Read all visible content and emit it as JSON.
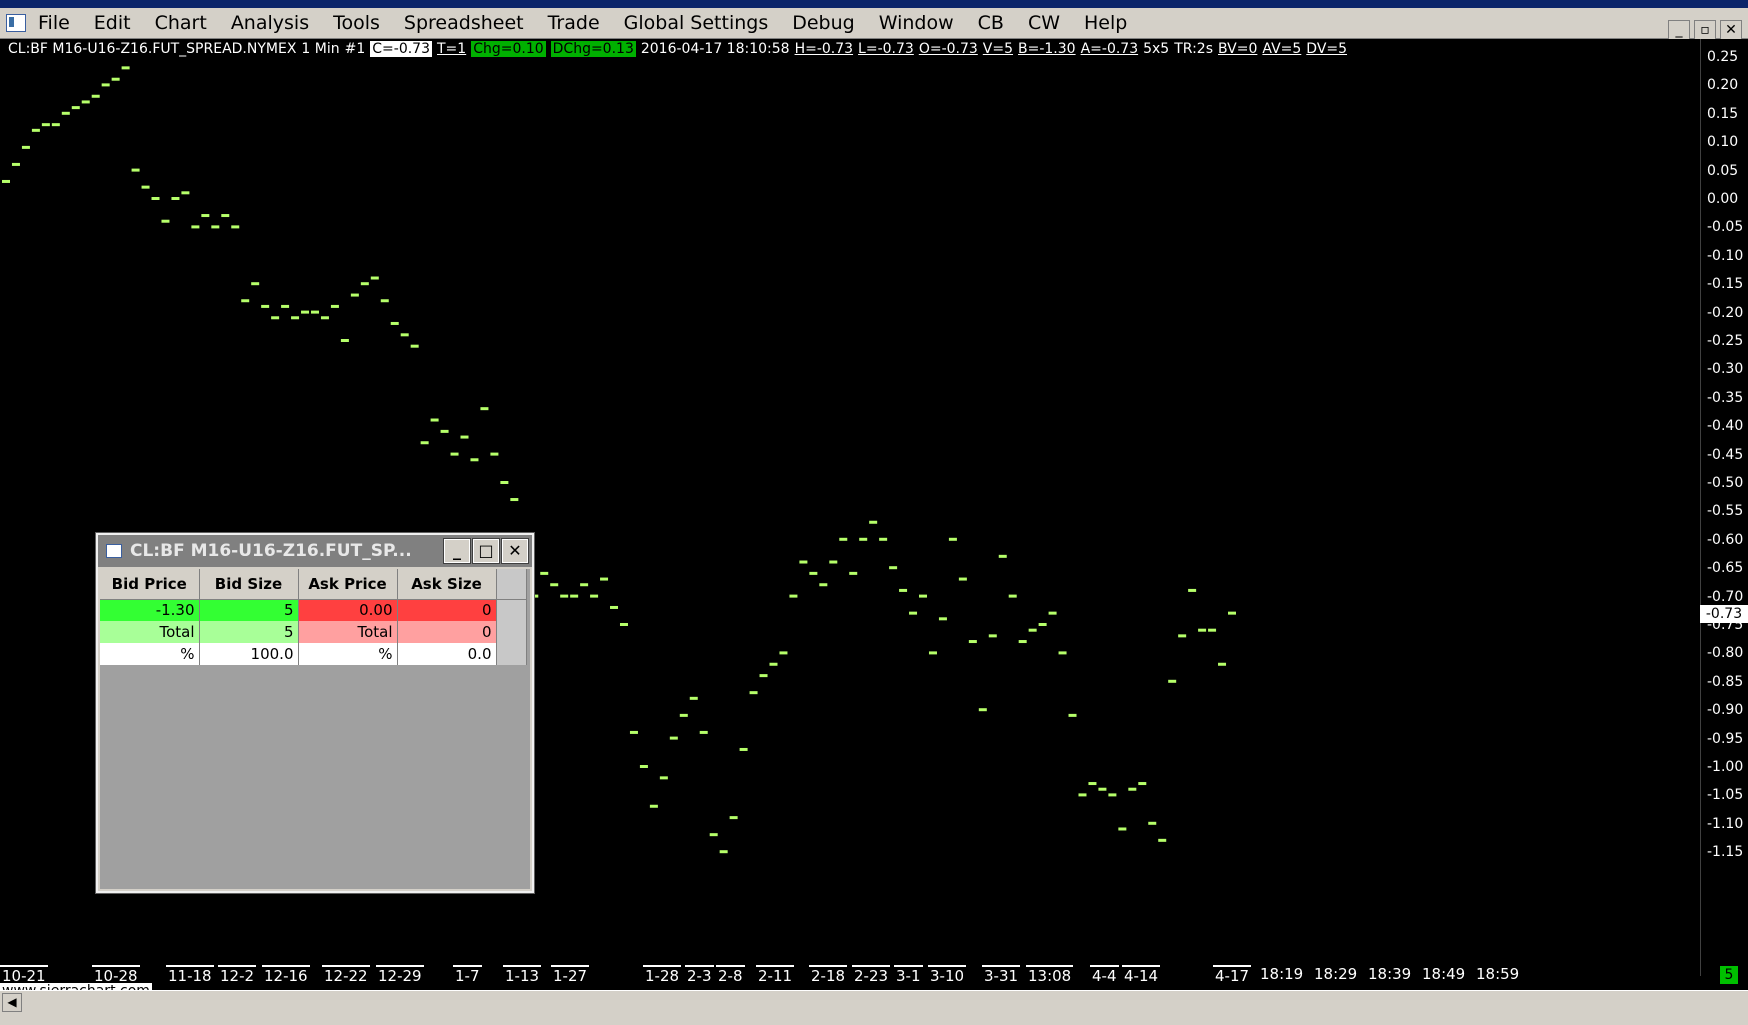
{
  "menu": {
    "items": [
      "File",
      "Edit",
      "Chart",
      "Analysis",
      "Tools",
      "Spreadsheet",
      "Trade",
      "Global Settings",
      "Debug",
      "Window",
      "CB",
      "CW",
      "Help"
    ],
    "window_controls": [
      "_",
      "▫",
      "✕"
    ]
  },
  "chart_header": {
    "symbol": "CL:BF M16-U16-Z16.FUT_SPREAD.NYMEX",
    "timeframe": "1 Min",
    "instance": "#1",
    "close": "C=-0.73",
    "ticks": "T=1",
    "change": "Chg=0.10",
    "dchange": "DChg=0.13",
    "datetime": "2016-04-17  18:10:58",
    "high": "H=-0.73",
    "low": "L=-0.73",
    "open": "O=-0.73",
    "volume": "V=5",
    "bid": "B=-1.30",
    "ask": "A=-0.73",
    "size": "5x5",
    "trade_rate": "TR:2s",
    "bid_volume": "BV=0",
    "ask_volume": "AV=5",
    "delta_volume": "DV=5"
  },
  "price_scale": [
    "0.25",
    "0.20",
    "0.15",
    "0.10",
    "0.05",
    "0.00",
    "-0.05",
    "-0.10",
    "-0.15",
    "-0.20",
    "-0.25",
    "-0.30",
    "-0.35",
    "-0.40",
    "-0.45",
    "-0.50",
    "-0.55",
    "-0.60",
    "-0.65",
    "-0.70",
    "-0.75",
    "-0.80",
    "-0.85",
    "-0.90",
    "-0.95",
    "-1.00",
    "-1.05",
    "-1.10",
    "-1.15"
  ],
  "last_price_tag": "-0.73",
  "time_axis": [
    "10-21",
    "10-28",
    "11-18",
    "12-2",
    "12-16",
    "12-22",
    "12-29",
    "1-7",
    "1-13",
    "1-27",
    "1-28",
    "2-3",
    "2-8",
    "2-11",
    "2-18",
    "2-23",
    "3-1",
    "3-10",
    "3-31",
    "13:08",
    "4-4",
    "4-14",
    "4-17",
    "18:19",
    "18:29",
    "18:39",
    "18:49",
    "18:59"
  ],
  "brand": "www.sierrachart.com",
  "corner_badge": "5",
  "colors": {
    "bar": "#b6ff6a",
    "background": "#000000",
    "bid_cell": "#33ff33",
    "ask_cell": "#ff4040"
  },
  "chart_data": {
    "type": "scatter",
    "title": "",
    "ylim": [
      -1.17,
      0.27
    ],
    "points": [
      [
        0,
        0.03
      ],
      [
        1,
        0.06
      ],
      [
        2,
        0.09
      ],
      [
        3,
        0.12
      ],
      [
        4,
        0.13
      ],
      [
        5,
        0.13
      ],
      [
        6,
        0.15
      ],
      [
        7,
        0.16
      ],
      [
        8,
        0.17
      ],
      [
        9,
        0.18
      ],
      [
        10,
        0.2
      ],
      [
        11,
        0.21
      ],
      [
        12,
        0.23
      ],
      [
        13,
        0.05
      ],
      [
        14,
        0.02
      ],
      [
        15,
        0.0
      ],
      [
        16,
        -0.04
      ],
      [
        17,
        0.0
      ],
      [
        18,
        0.01
      ],
      [
        19,
        -0.05
      ],
      [
        20,
        -0.03
      ],
      [
        21,
        -0.05
      ],
      [
        22,
        -0.03
      ],
      [
        23,
        -0.05
      ],
      [
        24,
        -0.18
      ],
      [
        25,
        -0.15
      ],
      [
        26,
        -0.19
      ],
      [
        27,
        -0.21
      ],
      [
        28,
        -0.19
      ],
      [
        29,
        -0.21
      ],
      [
        30,
        -0.2
      ],
      [
        31,
        -0.2
      ],
      [
        32,
        -0.21
      ],
      [
        33,
        -0.19
      ],
      [
        34,
        -0.25
      ],
      [
        35,
        -0.17
      ],
      [
        36,
        -0.15
      ],
      [
        37,
        -0.14
      ],
      [
        38,
        -0.18
      ],
      [
        39,
        -0.22
      ],
      [
        40,
        -0.24
      ],
      [
        41,
        -0.26
      ],
      [
        42,
        -0.43
      ],
      [
        43,
        -0.39
      ],
      [
        44,
        -0.41
      ],
      [
        45,
        -0.45
      ],
      [
        46,
        -0.42
      ],
      [
        47,
        -0.46
      ],
      [
        48,
        -0.37
      ],
      [
        49,
        -0.45
      ],
      [
        50,
        -0.5
      ],
      [
        51,
        -0.53
      ],
      [
        52,
        -0.68
      ],
      [
        53,
        -0.7
      ],
      [
        54,
        -0.66
      ],
      [
        55,
        -0.68
      ],
      [
        56,
        -0.7
      ],
      [
        57,
        -0.7
      ],
      [
        58,
        -0.68
      ],
      [
        59,
        -0.7
      ],
      [
        60,
        -0.67
      ],
      [
        61,
        -0.72
      ],
      [
        62,
        -0.75
      ],
      [
        63,
        -0.94
      ],
      [
        64,
        -1.0
      ],
      [
        65,
        -1.07
      ],
      [
        66,
        -1.02
      ],
      [
        67,
        -0.95
      ],
      [
        68,
        -0.91
      ],
      [
        69,
        -0.88
      ],
      [
        70,
        -0.94
      ],
      [
        71,
        -1.12
      ],
      [
        72,
        -1.15
      ],
      [
        73,
        -1.09
      ],
      [
        74,
        -0.97
      ],
      [
        75,
        -0.87
      ],
      [
        76,
        -0.84
      ],
      [
        77,
        -0.82
      ],
      [
        78,
        -0.8
      ],
      [
        79,
        -0.7
      ],
      [
        80,
        -0.64
      ],
      [
        81,
        -0.66
      ],
      [
        82,
        -0.68
      ],
      [
        83,
        -0.64
      ],
      [
        84,
        -0.6
      ],
      [
        85,
        -0.66
      ],
      [
        86,
        -0.6
      ],
      [
        87,
        -0.57
      ],
      [
        88,
        -0.6
      ],
      [
        89,
        -0.65
      ],
      [
        90,
        -0.69
      ],
      [
        91,
        -0.73
      ],
      [
        92,
        -0.7
      ],
      [
        93,
        -0.8
      ],
      [
        94,
        -0.74
      ],
      [
        95,
        -0.6
      ],
      [
        96,
        -0.67
      ],
      [
        97,
        -0.78
      ],
      [
        98,
        -0.9
      ],
      [
        99,
        -0.77
      ],
      [
        100,
        -0.63
      ],
      [
        101,
        -0.7
      ],
      [
        102,
        -0.78
      ],
      [
        103,
        -0.76
      ],
      [
        104,
        -0.75
      ],
      [
        105,
        -0.73
      ],
      [
        106,
        -0.8
      ],
      [
        107,
        -0.91
      ],
      [
        108,
        -1.05
      ],
      [
        109,
        -1.03
      ],
      [
        110,
        -1.04
      ],
      [
        111,
        -1.05
      ],
      [
        112,
        -1.11
      ],
      [
        113,
        -1.04
      ],
      [
        114,
        -1.03
      ],
      [
        115,
        -1.1
      ],
      [
        116,
        -1.13
      ],
      [
        117,
        -0.85
      ],
      [
        118,
        -0.77
      ],
      [
        119,
        -0.69
      ],
      [
        120,
        -0.76
      ],
      [
        121,
        -0.76
      ],
      [
        122,
        -0.82
      ],
      [
        123,
        -0.73
      ]
    ]
  },
  "dom_window": {
    "title": "CL:BF M16-U16-Z16.FUT_SP...",
    "headers": [
      "Bid Price",
      "Bid Size",
      "Ask Price",
      "Ask Size"
    ],
    "rows": [
      [
        "-1.30",
        "5",
        "0.00",
        "0"
      ],
      [
        "Total",
        "5",
        "Total",
        "0"
      ],
      [
        "%",
        "100.0",
        "%",
        "0.0"
      ]
    ],
    "buttons": [
      "_",
      "□",
      "✕"
    ]
  }
}
